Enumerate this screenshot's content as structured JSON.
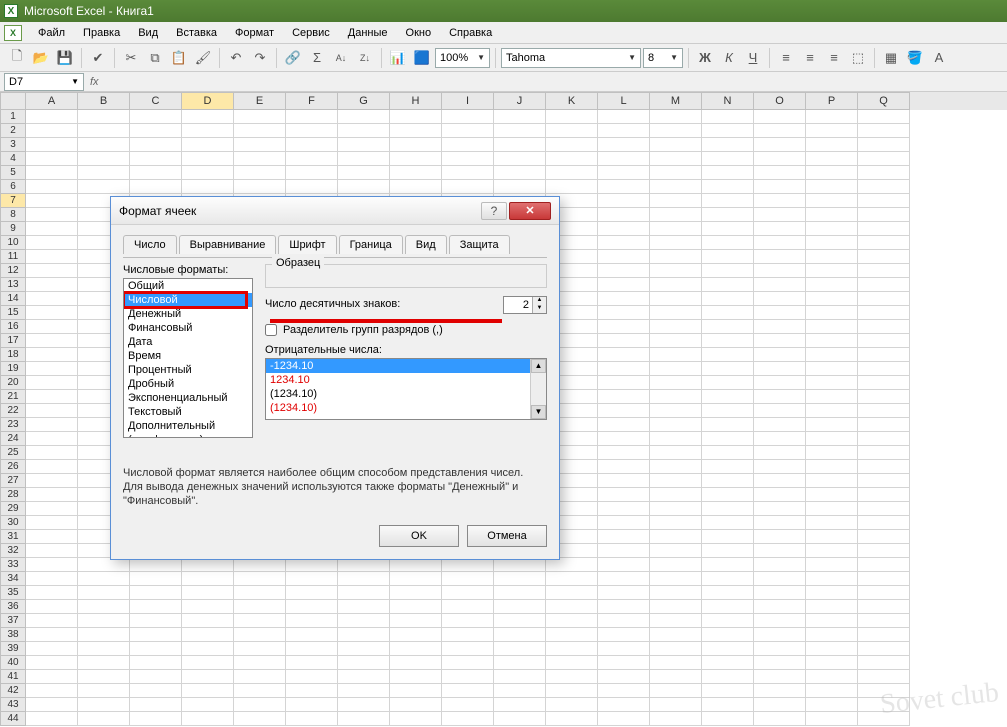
{
  "app": {
    "title": "Microsoft Excel - Книга1"
  },
  "menu": {
    "file": "Файл",
    "edit": "Правка",
    "view": "Вид",
    "insert": "Вставка",
    "format": "Формат",
    "tools": "Сервис",
    "data": "Данные",
    "window": "Окно",
    "help": "Справка"
  },
  "toolbar": {
    "zoom": "100%",
    "font": "Tahoma",
    "size": "8"
  },
  "namebox": "D7",
  "columns": [
    "A",
    "B",
    "C",
    "D",
    "E",
    "F",
    "G",
    "H",
    "I",
    "J",
    "K",
    "L",
    "M",
    "N",
    "O",
    "P",
    "Q"
  ],
  "selected_col": "D",
  "selected_row": 7,
  "row_count": 44,
  "dialog": {
    "title": "Формат ячеек",
    "tabs": [
      "Число",
      "Выравнивание",
      "Шрифт",
      "Граница",
      "Вид",
      "Защита"
    ],
    "active_tab": "Число",
    "formats_label": "Числовые форматы:",
    "formats": [
      "Общий",
      "Числовой",
      "Денежный",
      "Финансовый",
      "Дата",
      "Время",
      "Процентный",
      "Дробный",
      "Экспоненциальный",
      "Текстовый",
      "Дополнительный",
      "(все форматы)"
    ],
    "selected_format": "Числовой",
    "sample_label": "Образец",
    "decimals_label": "Число десятичных знаков:",
    "decimals_value": "2",
    "separator_label": "Разделитель групп разрядов (,)",
    "neg_label": "Отрицательные числа:",
    "neg_items": [
      {
        "text": "-1234.10",
        "selected": true,
        "red": false
      },
      {
        "text": "1234.10",
        "selected": false,
        "red": true
      },
      {
        "text": "(1234.10)",
        "selected": false,
        "red": false
      },
      {
        "text": "(1234.10)",
        "selected": false,
        "red": true
      }
    ],
    "desc1": "Числовой формат является наиболее общим способом представления чисел.",
    "desc2": "Для вывода денежных значений используются также форматы \"Денежный\" и \"Финансовый\".",
    "ok": "OK",
    "cancel": "Отмена"
  },
  "watermark": "Sovet club"
}
